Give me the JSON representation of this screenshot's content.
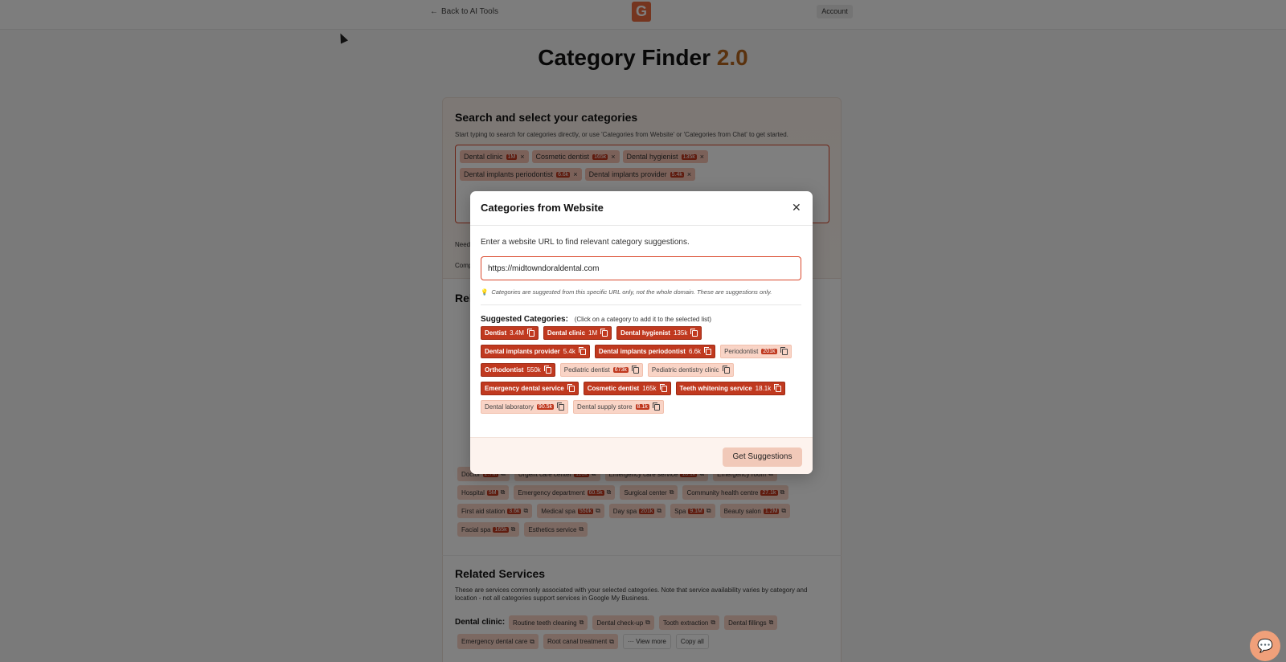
{
  "nav": {
    "back_label": "Back to AI Tools",
    "logo_letter": "G",
    "account_label": "Account"
  },
  "page": {
    "title": "Category Finder",
    "version": "2.0"
  },
  "search_card": {
    "title": "Search and select your categories",
    "hint": "Start typing to search for categories directly, or use 'Categories from Website' or 'Categories from Chat' to get started.",
    "selected_row1": [
      {
        "label": "Dental clinic",
        "count": "1M"
      },
      {
        "label": "Cosmetic dentist",
        "count": "165k"
      },
      {
        "label": "Dental hygienist",
        "count": "135k"
      }
    ],
    "selected_row2": [
      {
        "label": "Dental implants periodontist",
        "count": "6.6k"
      },
      {
        "label": "Dental implants provider",
        "count": "5.4k"
      }
    ],
    "need_text": "Need",
    "comp_text": "Comp"
  },
  "related_card": {
    "title": "Rel",
    "row_doctor": [
      {
        "label": "Doctor",
        "count": "2.7M"
      },
      {
        "label": "Urgent care center",
        "count": "110k"
      },
      {
        "label": "Emergency care service",
        "count": "18.1k"
      },
      {
        "label": "Emergency room",
        "count": ""
      }
    ],
    "row_hospital": [
      {
        "label": "Hospital",
        "count": "5M"
      },
      {
        "label": "Emergency department",
        "count": "60.5k"
      },
      {
        "label": "Surgical center",
        "count": ""
      },
      {
        "label": "Community health centre",
        "count": "27.1k"
      }
    ],
    "row_firstaid": [
      {
        "label": "First aid station",
        "count": "3.6k"
      },
      {
        "label": "Medical spa",
        "count": "550k"
      },
      {
        "label": "Day spa",
        "count": "201k"
      },
      {
        "label": "Spa",
        "count": "9.1M"
      },
      {
        "label": "Beauty salon",
        "count": "1.2M"
      }
    ],
    "row_facial": [
      {
        "label": "Facial spa",
        "count": "165k"
      },
      {
        "label": "Esthetics service",
        "count": ""
      }
    ]
  },
  "services_card": {
    "title": "Related Services",
    "description": "These are services commonly associated with your selected categories. Note that service availability varies by category and location - not all categories support services in Google My Business.",
    "group_label": "Dental clinic:",
    "services_row1": [
      "Routine teeth cleaning",
      "Dental check-up",
      "Tooth extraction",
      "Dental fillings"
    ],
    "services_row2": [
      "Emergency dental care",
      "Root canal treatment"
    ],
    "view_more": "··· View more",
    "copy_all": "Copy all"
  },
  "modal": {
    "title": "Categories from Website",
    "intro": "Enter a website URL to find relevant category suggestions.",
    "url_value": "https://midtowndoraldental.com",
    "tip": "Categories are suggested from this specific URL only, not the whole domain. These are suggestions only.",
    "suggested_title": "Suggested Categories:",
    "suggested_hint": "(Click on a category to add it to the selected list)",
    "rows": [
      [
        {
          "label": "Dentist",
          "count": "3.4M",
          "selected": true
        },
        {
          "label": "Dental clinic",
          "count": "1M",
          "selected": true
        },
        {
          "label": "Dental hygienist",
          "count": "135k",
          "selected": true
        }
      ],
      [
        {
          "label": "Dental implants provider",
          "count": "5.4k",
          "selected": true
        },
        {
          "label": "Dental implants periodontist",
          "count": "6.6k",
          "selected": true
        },
        {
          "label": "Periodontist",
          "count": "201k",
          "selected": false
        }
      ],
      [
        {
          "label": "Orthodontist",
          "count": "550k",
          "selected": true
        },
        {
          "label": "Pediatric dentist",
          "count": "673k",
          "selected": false
        },
        {
          "label": "Pediatric dentistry clinic",
          "count": "",
          "selected": false
        }
      ],
      [
        {
          "label": "Emergency dental service",
          "count": "",
          "selected": true
        },
        {
          "label": "Cosmetic dentist",
          "count": "165k",
          "selected": true
        },
        {
          "label": "Teeth whitening service",
          "count": "18.1k",
          "selected": true
        }
      ],
      [
        {
          "label": "Dental laboratory",
          "count": "90.5k",
          "selected": false
        },
        {
          "label": "Dental supply store",
          "count": "8.1k",
          "selected": false
        }
      ]
    ],
    "button_label": "Get Suggestions"
  },
  "colors": {
    "accent": "#c0391f",
    "chip_light": "#f9d4c6",
    "brand": "#ea6a3f",
    "version": "#b5651d"
  }
}
